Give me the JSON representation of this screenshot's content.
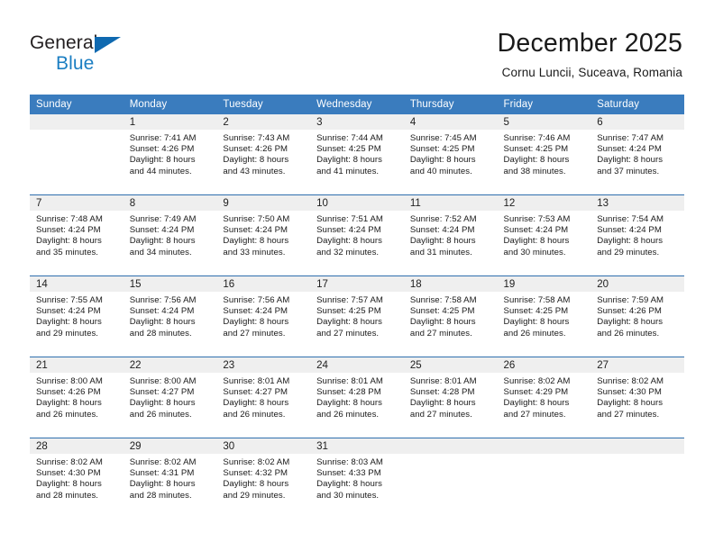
{
  "brand": {
    "name_part1": "General",
    "name_part2": "Blue",
    "triangle_color": "#0f69b0",
    "part1_color": "#231f20",
    "part2_color": "#1b7ec2"
  },
  "header": {
    "title": "December 2025",
    "subtitle": "Cornu Luncii, Suceava, Romania"
  },
  "theme": {
    "header_bg": "#3a7cbe",
    "header_text": "#ffffff",
    "row_divider": "#2f6fae",
    "daynum_band_bg": "#efefef",
    "cell_bg": "#ffffff",
    "body_text": "#1a1a1a"
  },
  "calendar": {
    "weekday_headers": [
      "Sunday",
      "Monday",
      "Tuesday",
      "Wednesday",
      "Thursday",
      "Friday",
      "Saturday"
    ],
    "weeks": [
      [
        {
          "day": "",
          "lines": []
        },
        {
          "day": "1",
          "lines": [
            "Sunrise: 7:41 AM",
            "Sunset: 4:26 PM",
            "Daylight: 8 hours",
            "and 44 minutes."
          ]
        },
        {
          "day": "2",
          "lines": [
            "Sunrise: 7:43 AM",
            "Sunset: 4:26 PM",
            "Daylight: 8 hours",
            "and 43 minutes."
          ]
        },
        {
          "day": "3",
          "lines": [
            "Sunrise: 7:44 AM",
            "Sunset: 4:25 PM",
            "Daylight: 8 hours",
            "and 41 minutes."
          ]
        },
        {
          "day": "4",
          "lines": [
            "Sunrise: 7:45 AM",
            "Sunset: 4:25 PM",
            "Daylight: 8 hours",
            "and 40 minutes."
          ]
        },
        {
          "day": "5",
          "lines": [
            "Sunrise: 7:46 AM",
            "Sunset: 4:25 PM",
            "Daylight: 8 hours",
            "and 38 minutes."
          ]
        },
        {
          "day": "6",
          "lines": [
            "Sunrise: 7:47 AM",
            "Sunset: 4:24 PM",
            "Daylight: 8 hours",
            "and 37 minutes."
          ]
        }
      ],
      [
        {
          "day": "7",
          "lines": [
            "Sunrise: 7:48 AM",
            "Sunset: 4:24 PM",
            "Daylight: 8 hours",
            "and 35 minutes."
          ]
        },
        {
          "day": "8",
          "lines": [
            "Sunrise: 7:49 AM",
            "Sunset: 4:24 PM",
            "Daylight: 8 hours",
            "and 34 minutes."
          ]
        },
        {
          "day": "9",
          "lines": [
            "Sunrise: 7:50 AM",
            "Sunset: 4:24 PM",
            "Daylight: 8 hours",
            "and 33 minutes."
          ]
        },
        {
          "day": "10",
          "lines": [
            "Sunrise: 7:51 AM",
            "Sunset: 4:24 PM",
            "Daylight: 8 hours",
            "and 32 minutes."
          ]
        },
        {
          "day": "11",
          "lines": [
            "Sunrise: 7:52 AM",
            "Sunset: 4:24 PM",
            "Daylight: 8 hours",
            "and 31 minutes."
          ]
        },
        {
          "day": "12",
          "lines": [
            "Sunrise: 7:53 AM",
            "Sunset: 4:24 PM",
            "Daylight: 8 hours",
            "and 30 minutes."
          ]
        },
        {
          "day": "13",
          "lines": [
            "Sunrise: 7:54 AM",
            "Sunset: 4:24 PM",
            "Daylight: 8 hours",
            "and 29 minutes."
          ]
        }
      ],
      [
        {
          "day": "14",
          "lines": [
            "Sunrise: 7:55 AM",
            "Sunset: 4:24 PM",
            "Daylight: 8 hours",
            "and 29 minutes."
          ]
        },
        {
          "day": "15",
          "lines": [
            "Sunrise: 7:56 AM",
            "Sunset: 4:24 PM",
            "Daylight: 8 hours",
            "and 28 minutes."
          ]
        },
        {
          "day": "16",
          "lines": [
            "Sunrise: 7:56 AM",
            "Sunset: 4:24 PM",
            "Daylight: 8 hours",
            "and 27 minutes."
          ]
        },
        {
          "day": "17",
          "lines": [
            "Sunrise: 7:57 AM",
            "Sunset: 4:25 PM",
            "Daylight: 8 hours",
            "and 27 minutes."
          ]
        },
        {
          "day": "18",
          "lines": [
            "Sunrise: 7:58 AM",
            "Sunset: 4:25 PM",
            "Daylight: 8 hours",
            "and 27 minutes."
          ]
        },
        {
          "day": "19",
          "lines": [
            "Sunrise: 7:58 AM",
            "Sunset: 4:25 PM",
            "Daylight: 8 hours",
            "and 26 minutes."
          ]
        },
        {
          "day": "20",
          "lines": [
            "Sunrise: 7:59 AM",
            "Sunset: 4:26 PM",
            "Daylight: 8 hours",
            "and 26 minutes."
          ]
        }
      ],
      [
        {
          "day": "21",
          "lines": [
            "Sunrise: 8:00 AM",
            "Sunset: 4:26 PM",
            "Daylight: 8 hours",
            "and 26 minutes."
          ]
        },
        {
          "day": "22",
          "lines": [
            "Sunrise: 8:00 AM",
            "Sunset: 4:27 PM",
            "Daylight: 8 hours",
            "and 26 minutes."
          ]
        },
        {
          "day": "23",
          "lines": [
            "Sunrise: 8:01 AM",
            "Sunset: 4:27 PM",
            "Daylight: 8 hours",
            "and 26 minutes."
          ]
        },
        {
          "day": "24",
          "lines": [
            "Sunrise: 8:01 AM",
            "Sunset: 4:28 PM",
            "Daylight: 8 hours",
            "and 26 minutes."
          ]
        },
        {
          "day": "25",
          "lines": [
            "Sunrise: 8:01 AM",
            "Sunset: 4:28 PM",
            "Daylight: 8 hours",
            "and 27 minutes."
          ]
        },
        {
          "day": "26",
          "lines": [
            "Sunrise: 8:02 AM",
            "Sunset: 4:29 PM",
            "Daylight: 8 hours",
            "and 27 minutes."
          ]
        },
        {
          "day": "27",
          "lines": [
            "Sunrise: 8:02 AM",
            "Sunset: 4:30 PM",
            "Daylight: 8 hours",
            "and 27 minutes."
          ]
        }
      ],
      [
        {
          "day": "28",
          "lines": [
            "Sunrise: 8:02 AM",
            "Sunset: 4:30 PM",
            "Daylight: 8 hours",
            "and 28 minutes."
          ]
        },
        {
          "day": "29",
          "lines": [
            "Sunrise: 8:02 AM",
            "Sunset: 4:31 PM",
            "Daylight: 8 hours",
            "and 28 minutes."
          ]
        },
        {
          "day": "30",
          "lines": [
            "Sunrise: 8:02 AM",
            "Sunset: 4:32 PM",
            "Daylight: 8 hours",
            "and 29 minutes."
          ]
        },
        {
          "day": "31",
          "lines": [
            "Sunrise: 8:03 AM",
            "Sunset: 4:33 PM",
            "Daylight: 8 hours",
            "and 30 minutes."
          ]
        },
        {
          "day": "",
          "lines": []
        },
        {
          "day": "",
          "lines": []
        },
        {
          "day": "",
          "lines": []
        }
      ]
    ]
  }
}
